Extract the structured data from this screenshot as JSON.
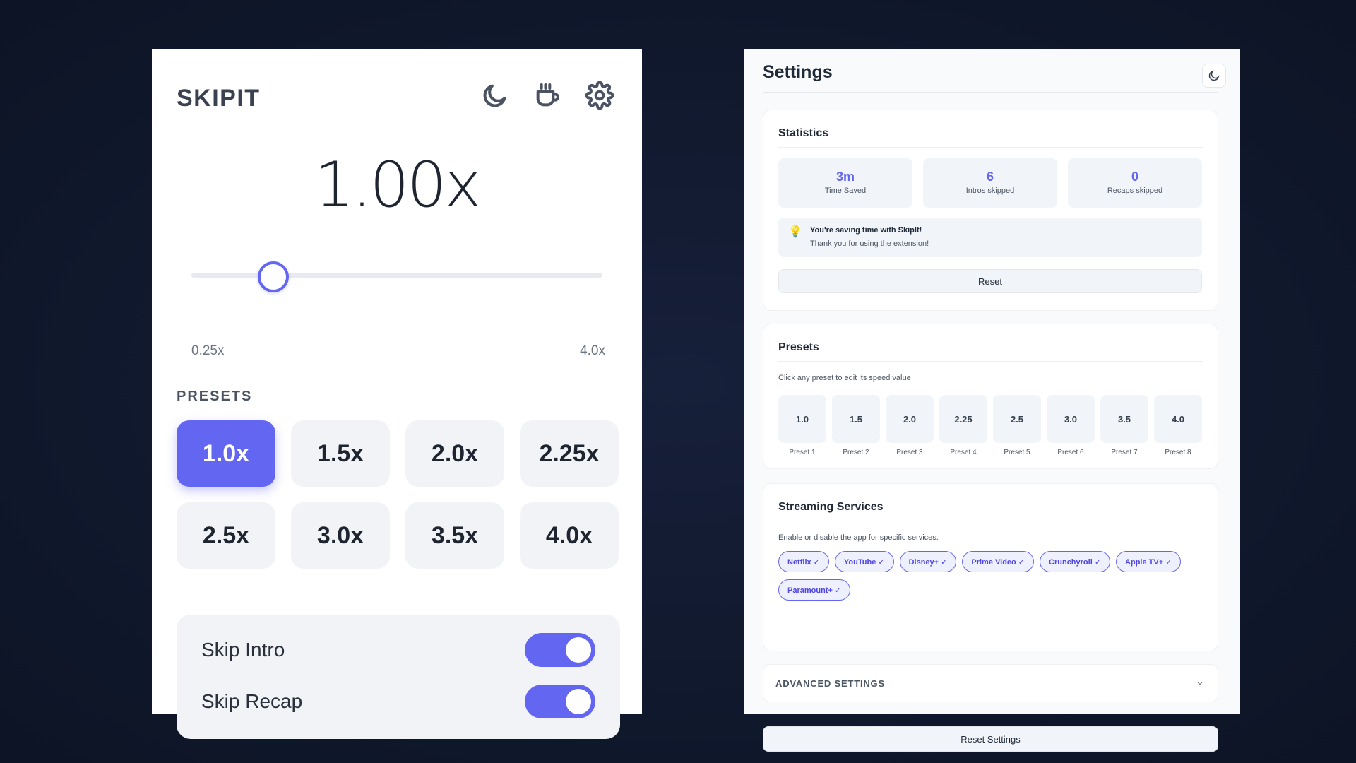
{
  "popup": {
    "brand": "SKIPIT",
    "icons": [
      "moon-icon",
      "coffee-icon",
      "gear-icon"
    ],
    "speed_display": "1.00x",
    "slider": {
      "value": 1.0,
      "min_label": "0.25x",
      "max_label": "4.0x",
      "min": 0.25,
      "max": 4.0
    },
    "presets_label": "PRESETS",
    "presets": [
      "1.0x",
      "1.5x",
      "2.0x",
      "2.25x",
      "2.5x",
      "3.0x",
      "3.5x",
      "4.0x"
    ],
    "active_preset": 0,
    "toggles": [
      {
        "label": "Skip Intro",
        "on": true
      },
      {
        "label": "Skip Recap",
        "on": true
      }
    ],
    "accent": "#6366f1"
  },
  "settings": {
    "title": "Settings",
    "statistics": {
      "title": "Statistics",
      "items": [
        {
          "value": "3m",
          "label": "Time Saved"
        },
        {
          "value": "6",
          "label": "Intros skipped"
        },
        {
          "value": "0",
          "label": "Recaps skipped"
        }
      ],
      "tip_title": "You're saving time with SkipIt!",
      "tip_text": "Thank you for using the extension!",
      "reset_label": "Reset"
    },
    "presets": {
      "title": "Presets",
      "description": "Click any preset to edit its speed value",
      "items": [
        {
          "value": "1.0",
          "caption": "Preset 1"
        },
        {
          "value": "1.5",
          "caption": "Preset 2"
        },
        {
          "value": "2.0",
          "caption": "Preset 3"
        },
        {
          "value": "2.25",
          "caption": "Preset 4"
        },
        {
          "value": "2.5",
          "caption": "Preset 5"
        },
        {
          "value": "3.0",
          "caption": "Preset 6"
        },
        {
          "value": "3.5",
          "caption": "Preset 7"
        },
        {
          "value": "4.0",
          "caption": "Preset 8"
        }
      ]
    },
    "streaming": {
      "title": "Streaming Services",
      "description": "Enable or disable the app for specific services.",
      "services": [
        "Netflix ✓",
        "YouTube ✓",
        "Disney+ ✓",
        "Prime Video ✓",
        "Crunchyroll ✓",
        "Apple TV+ ✓",
        "Paramount+ ✓"
      ]
    },
    "advanced_label": "ADVANCED SETTINGS",
    "reset_settings_label": "Reset Settings"
  }
}
